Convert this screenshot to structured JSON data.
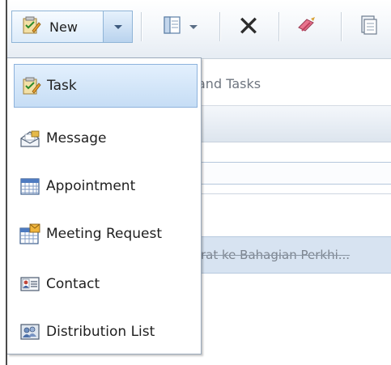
{
  "toolbar": {
    "new_label": "New",
    "icons": [
      "new-task-icon",
      "dropdown-arrow-icon",
      "view-pane-icon",
      "delete-icon",
      "flag-icon",
      "more-icon"
    ],
    "delete_glyph": "✕"
  },
  "background": {
    "label_partial": "and Tasks",
    "row_text": "rat ke Bahagian Perkhi..."
  },
  "new_menu": {
    "items": [
      {
        "label": "Task",
        "icon": "task-icon",
        "highlighted": true
      },
      {
        "label": "Message",
        "icon": "message-icon"
      },
      {
        "label": "Appointment",
        "icon": "calendar-icon"
      },
      {
        "label": "Meeting Request",
        "icon": "meeting-request-icon"
      },
      {
        "label": "Contact",
        "icon": "contact-card-icon"
      },
      {
        "label": "Distribution List",
        "icon": "distribution-list-icon"
      }
    ]
  },
  "colors": {
    "hover_bg": "#c6ddf5",
    "hover_border": "#8db2dc",
    "row_highlight": "#d7e3f1"
  }
}
